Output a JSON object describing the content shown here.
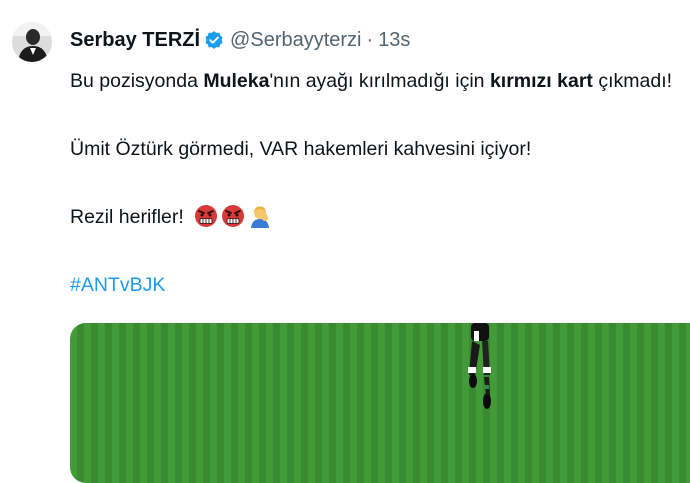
{
  "tweet": {
    "author_name": "Serbay TERZİ",
    "handle": "@Serbayyterzi",
    "separator": "·",
    "time": "13s",
    "line1": {
      "p1": "Bu pozisyonda ",
      "b1": "Muleka",
      "p2": "'nın ayağı kırılmadığı için ",
      "b2": "kırmızı kart",
      "p3": " çıkmadı!"
    },
    "line2": "Ümit Öztürk görmedi, VAR hakemleri kahvesini içiyor!",
    "line3": "Rezil herifler!",
    "emojis": [
      "angry-face-icon",
      "angry-face-icon",
      "woman-facepalming-icon"
    ],
    "hashtag": "#ANTvBJK"
  },
  "colors": {
    "link": "#1d9bf0",
    "verified": "#1d9bf0",
    "secondary_text": "#536471",
    "pitch_green": "#3f9a36"
  }
}
